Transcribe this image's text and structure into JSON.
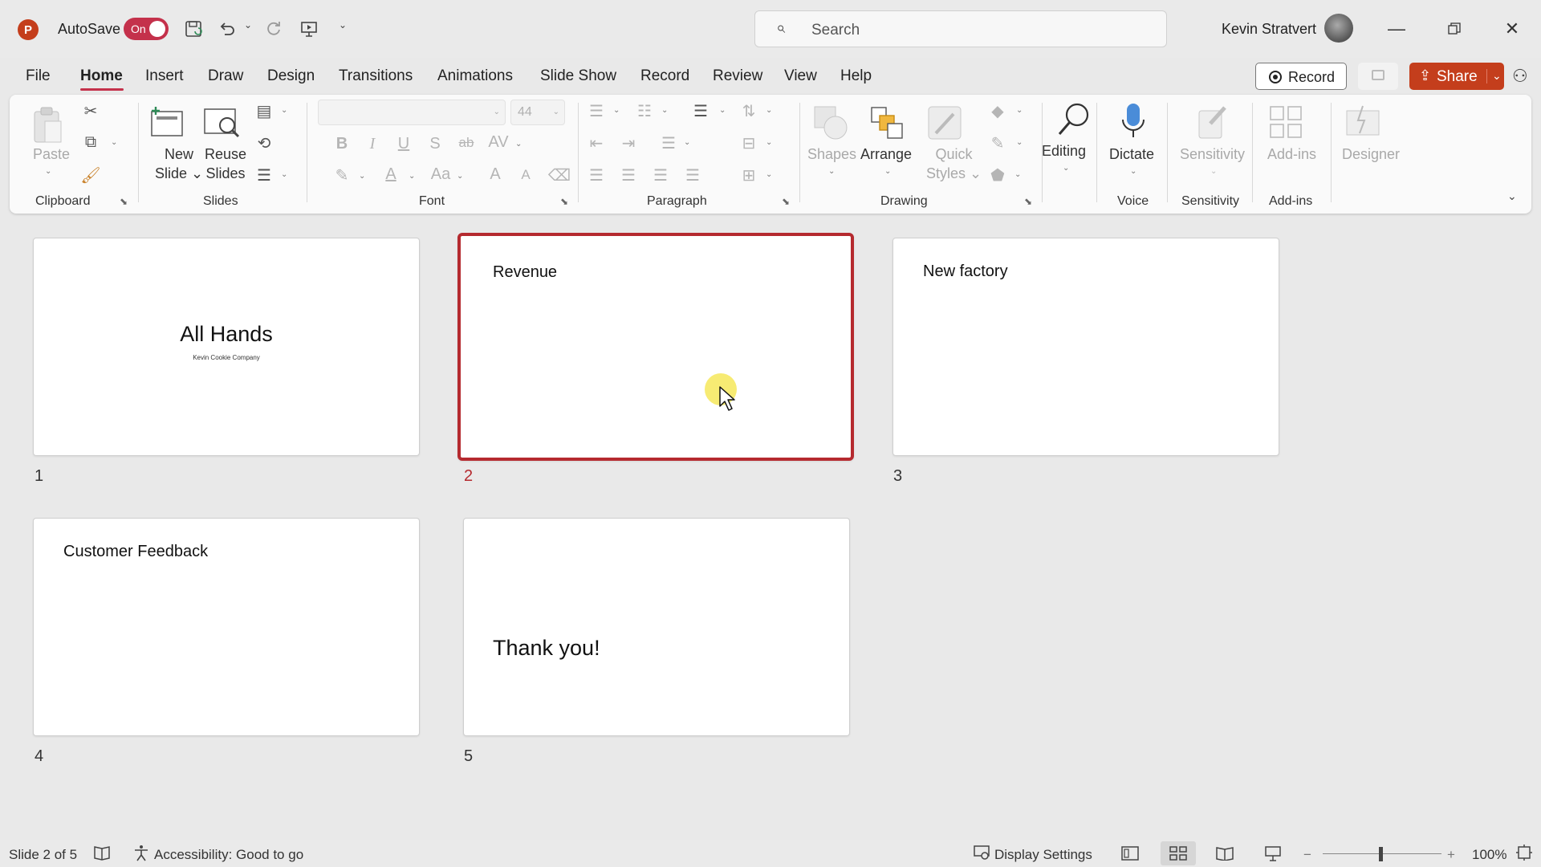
{
  "titlebar": {
    "app_logo": "P",
    "autosave_label": "AutoSave",
    "autosave_state": "On",
    "save_icon": "save-icon",
    "undo_icon": "undo-icon",
    "redo_icon": "redo-icon",
    "present_icon": "present-from-start-icon",
    "search_placeholder": "Search",
    "user_name": "Kevin Stratvert"
  },
  "menu": {
    "tabs": [
      "File",
      "Home",
      "Insert",
      "Draw",
      "Design",
      "Transitions",
      "Animations",
      "Slide Show",
      "Record",
      "Review",
      "View",
      "Help"
    ],
    "active_tab": "Home",
    "record_label": "Record",
    "share_label": "Share"
  },
  "ribbon": {
    "clipboard": {
      "paste": "Paste",
      "group": "Clipboard"
    },
    "slides": {
      "new_slide": [
        "New",
        "Slide"
      ],
      "reuse_slides": [
        "Reuse",
        "Slides"
      ],
      "group": "Slides"
    },
    "font": {
      "font_name": "",
      "font_size": "44",
      "bold": "B",
      "italic": "I",
      "underline": "U",
      "shadow": "S",
      "strike": "ab",
      "spacing": "AV",
      "color": "A",
      "case": "Aa",
      "grow": "A",
      "shrink": "A",
      "group": "Font"
    },
    "paragraph": {
      "group": "Paragraph"
    },
    "drawing": {
      "shapes": "Shapes",
      "arrange": "Arrange",
      "quick_styles": [
        "Quick",
        "Styles"
      ],
      "group": "Drawing"
    },
    "editing": {
      "label": "Editing"
    },
    "voice": {
      "dictate": "Dictate",
      "group": "Voice"
    },
    "sensitivity": {
      "label": "Sensitivity",
      "group": "Sensitivity"
    },
    "addins": {
      "label": "Add-ins",
      "group": "Add-ins"
    },
    "designer": {
      "label": "Designer"
    }
  },
  "slides": [
    {
      "number": "1",
      "title": "All Hands",
      "subtitle": "Kevin Cookie Company"
    },
    {
      "number": "2",
      "title": "Revenue"
    },
    {
      "number": "3",
      "title": "New factory"
    },
    {
      "number": "4",
      "title": "Customer Feedback"
    },
    {
      "number": "5",
      "title": "Thank you!"
    }
  ],
  "selected_slide": 2,
  "statusbar": {
    "slide_position": "Slide 2 of 5",
    "accessibility": "Accessibility: Good to go",
    "display_settings": "Display Settings",
    "zoom": "100%"
  },
  "colors": {
    "accent": "#c4314b",
    "share": "#c43e1c",
    "selection": "#b52a2f"
  }
}
